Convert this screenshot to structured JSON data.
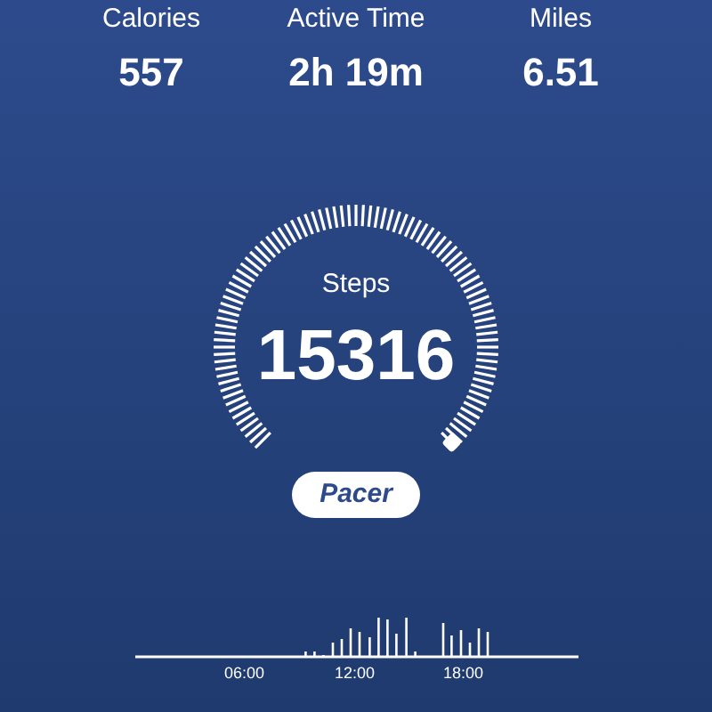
{
  "stats": [
    {
      "label": "Calories",
      "value": "557"
    },
    {
      "label": "Active Time",
      "value": "2h 19m"
    },
    {
      "label": "Miles",
      "value": "6.51"
    }
  ],
  "gauge": {
    "label": "Steps",
    "value": "15316"
  },
  "logo": "Pacer",
  "timeline": {
    "labels": [
      "06:00",
      "12:00",
      "18:00"
    ]
  }
}
